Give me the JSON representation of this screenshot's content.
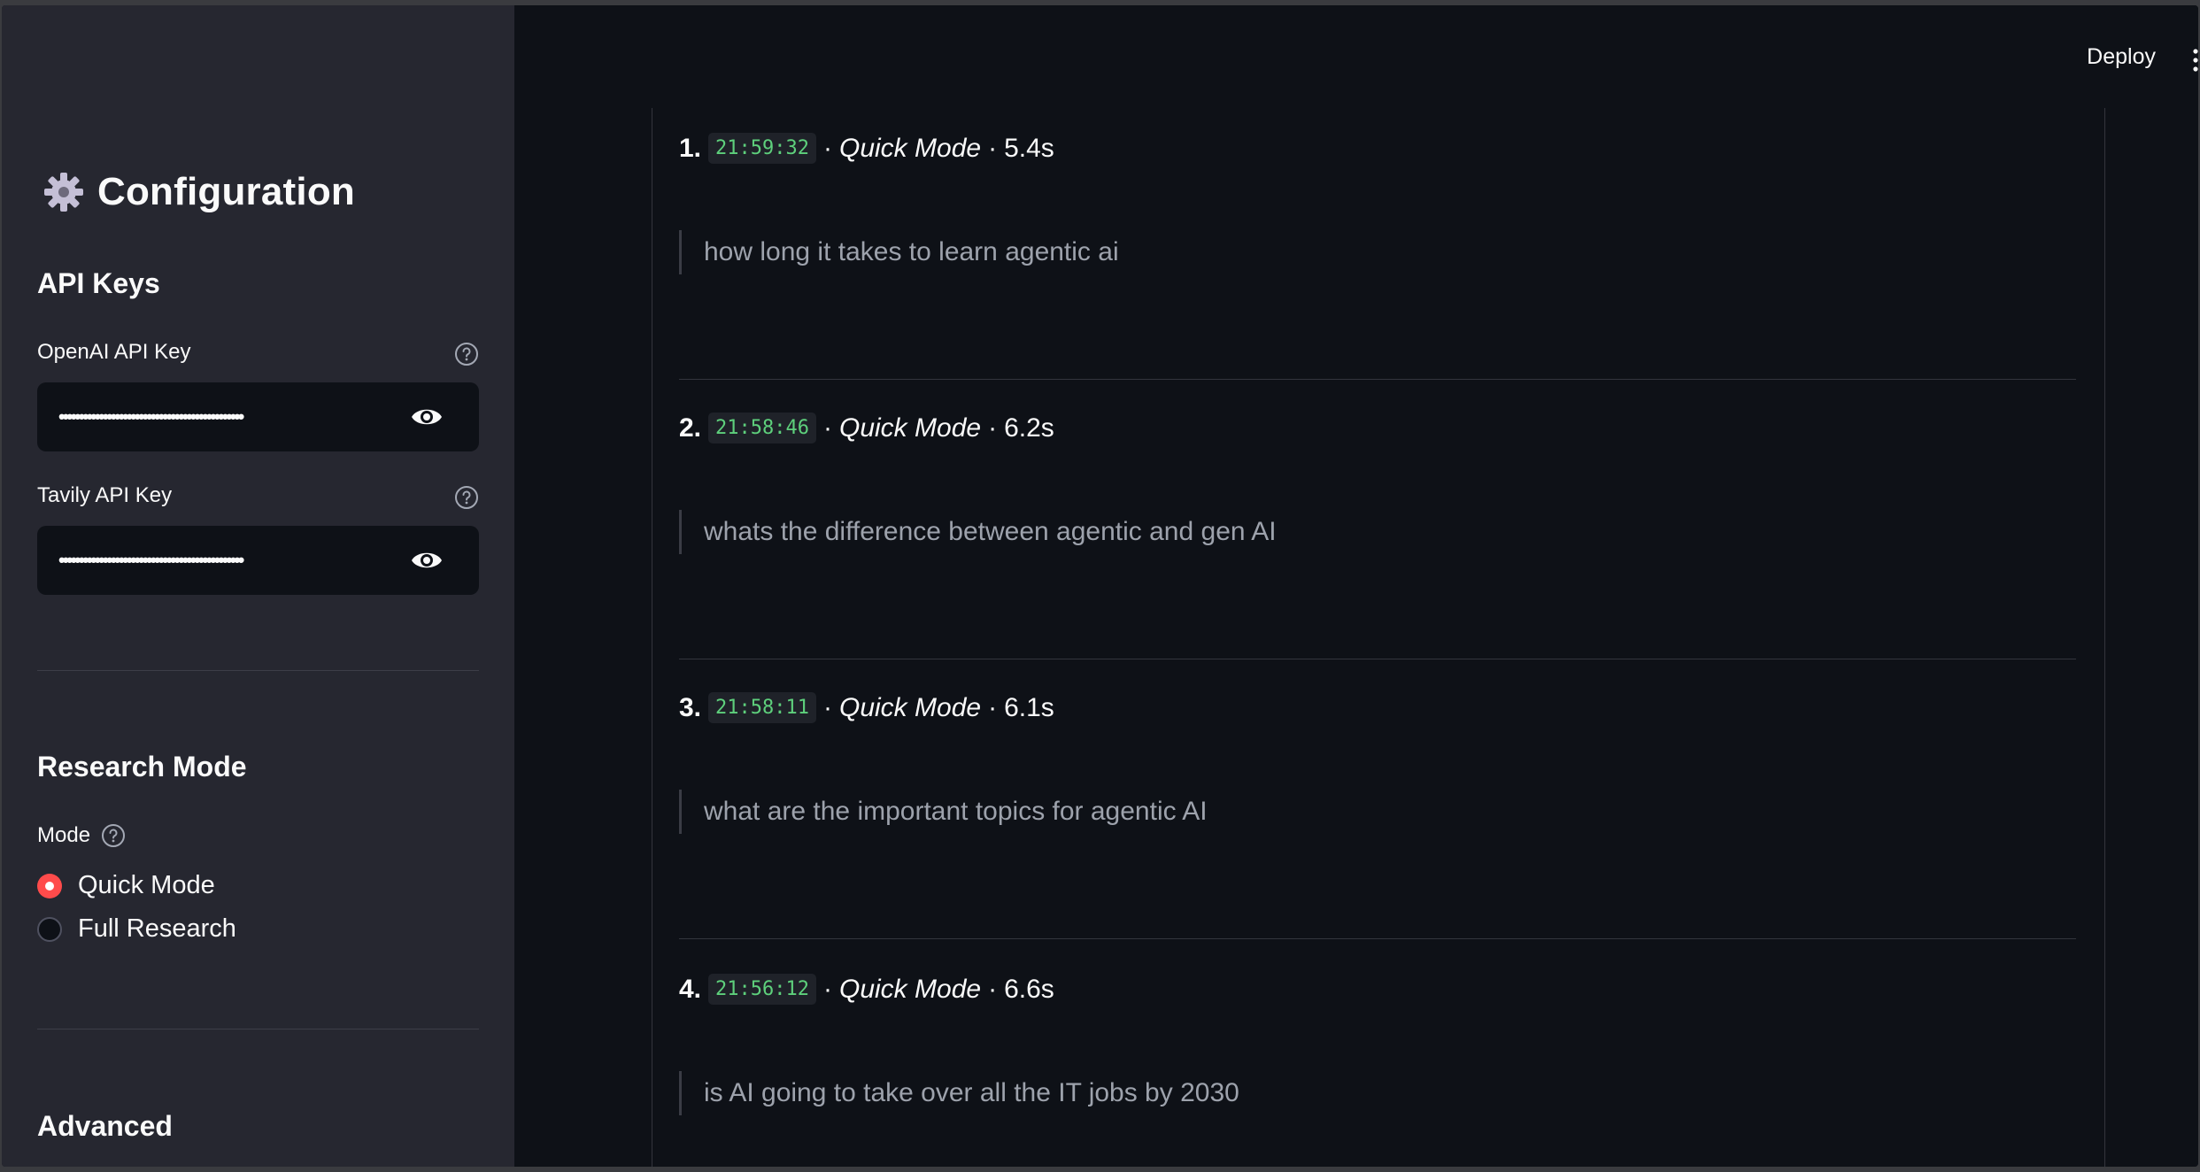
{
  "sidebar": {
    "title": "Configuration",
    "api_keys_heading": "API Keys",
    "openai_label": "OpenAI API Key",
    "openai_value": "••••••••••••••••••••••••••••••••••••••••••••••",
    "tavily_label": "Tavily API Key",
    "tavily_value": "••••••••••••••••••••••••••••••••••••••••••••••",
    "research_mode_heading": "Research Mode",
    "mode_label": "Mode",
    "mode_options": [
      {
        "label": "Quick Mode",
        "selected": true
      },
      {
        "label": "Full Research",
        "selected": false
      }
    ],
    "advanced_heading": "Advanced"
  },
  "header": {
    "deploy_label": "Deploy"
  },
  "history": [
    {
      "num": "1.",
      "time": "21:59:32",
      "sep1": "·",
      "mode": "Quick Mode",
      "sep2": "·",
      "duration": "5.4s",
      "query": "how long it takes to learn agentic ai"
    },
    {
      "num": "2.",
      "time": "21:58:46",
      "sep1": "·",
      "mode": "Quick Mode",
      "sep2": "·",
      "duration": "6.2s",
      "query": "whats the difference between agentic and gen AI"
    },
    {
      "num": "3.",
      "time": "21:58:11",
      "sep1": "·",
      "mode": "Quick Mode",
      "sep2": "·",
      "duration": "6.1s",
      "query": "what are the important topics for agentic AI"
    },
    {
      "num": "4.",
      "time": "21:56:12",
      "sep1": "·",
      "mode": "Quick Mode",
      "sep2": "·",
      "duration": "6.6s",
      "query": "is AI going to take over all the IT jobs by 2030"
    }
  ],
  "colors": {
    "accent": "#ff4b4b",
    "timestamp": "#5ed07c",
    "sidebar_bg": "#262730",
    "main_bg": "#0e1117"
  }
}
